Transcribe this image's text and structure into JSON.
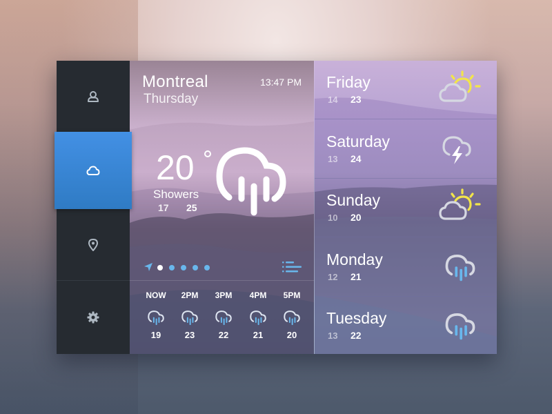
{
  "sidebar": {
    "items": [
      {
        "id": "profile",
        "icon": "user-icon",
        "active": false
      },
      {
        "id": "weather",
        "icon": "cloud-icon",
        "active": true
      },
      {
        "id": "location",
        "icon": "map-pin-icon",
        "active": false
      },
      {
        "id": "settings",
        "icon": "gear-icon",
        "active": false
      }
    ]
  },
  "current": {
    "city": "Montreal",
    "day": "Thursday",
    "time": "13:47 PM",
    "temperature": "20",
    "degree_symbol": "°",
    "condition": "Showers",
    "low": "17",
    "high": "25",
    "icon": "rain-cloud-icon",
    "pager": {
      "total": 5,
      "active_index": 0
    }
  },
  "hourly": [
    {
      "label": "NOW",
      "temp": "19",
      "icon": "rain-cloud-icon"
    },
    {
      "label": "2PM",
      "temp": "23",
      "icon": "rain-cloud-icon"
    },
    {
      "label": "3PM",
      "temp": "22",
      "icon": "rain-cloud-icon"
    },
    {
      "label": "4PM",
      "temp": "21",
      "icon": "rain-cloud-icon"
    },
    {
      "label": "5PM",
      "temp": "20",
      "icon": "rain-cloud-icon"
    }
  ],
  "forecast": [
    {
      "day": "Friday",
      "low": "14",
      "high": "23",
      "icon": "partly-sunny-icon"
    },
    {
      "day": "Saturday",
      "low": "13",
      "high": "24",
      "icon": "thunderstorm-icon"
    },
    {
      "day": "Sunday",
      "low": "10",
      "high": "20",
      "icon": "partly-sunny-icon"
    },
    {
      "day": "Monday",
      "low": "12",
      "high": "21",
      "icon": "rain-cloud-icon"
    },
    {
      "day": "Tuesday",
      "low": "13",
      "high": "22",
      "icon": "rain-cloud-icon"
    }
  ],
  "colors": {
    "sidebar_bg": "#262b31",
    "accent_blue": "#3d8ad8",
    "rain_blue": "#69b7ec",
    "sun_yellow": "#f2e54a",
    "cloud_grey": "#d6d8e2"
  }
}
